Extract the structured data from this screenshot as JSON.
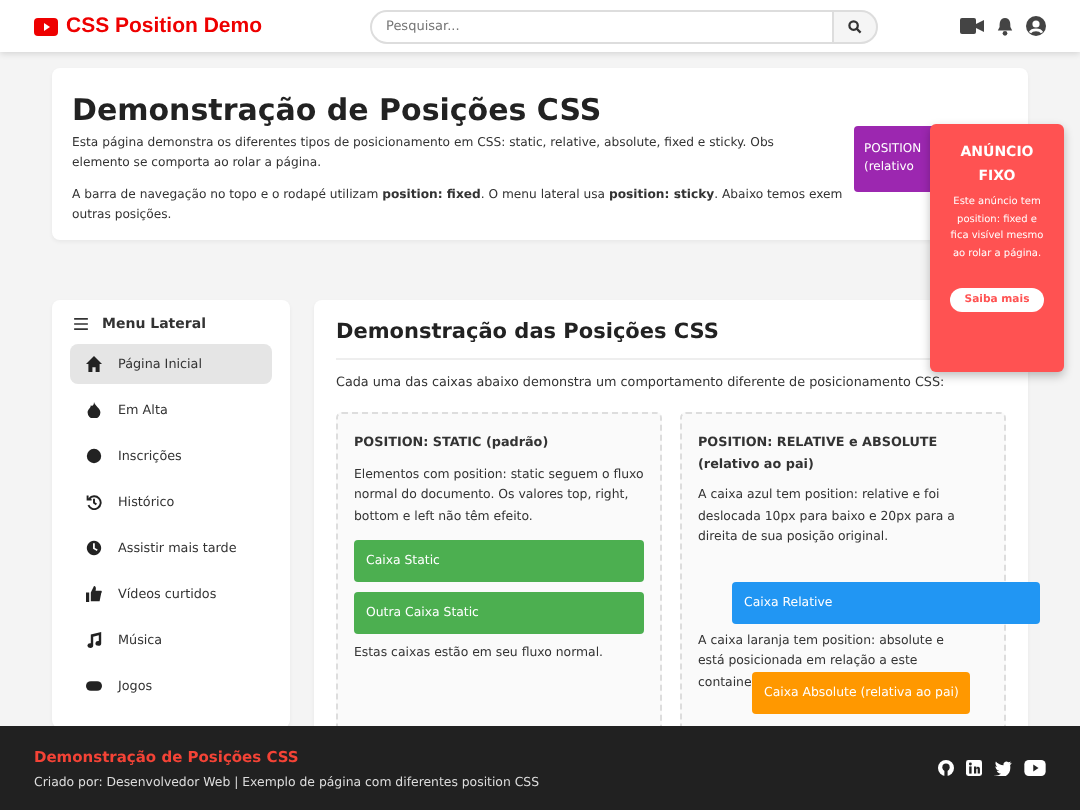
{
  "header": {
    "logo": "CSS Position Demo",
    "search": {
      "placeholder": "Pesquisar..."
    }
  },
  "intro": {
    "title": "Demonstração de Posições CSS",
    "paragraphs": [
      [
        "Esta página demonstra os diferentes tipos de posicionamento em CSS: static, relative, absolute, fixed e sticky. Obs",
        "elemento se comporta ao rolar a página."
      ],
      [
        "A barra de navegação no topo e o rodapé utilizam **position: fixed**. O menu lateral usa **position: sticky**. Abaixo temos exem",
        "outras posições."
      ]
    ],
    "overlay_lines": [
      "POSITION",
      "(relativo"
    ]
  },
  "sidebar": {
    "title": "Menu Lateral",
    "items": [
      {
        "label": "Página Inicial",
        "selected": true
      },
      {
        "label": "Em Alta",
        "selected": false
      },
      {
        "label": "Inscrições",
        "selected": false
      },
      {
        "label": "Histórico",
        "selected": false
      },
      {
        "label": "Assistir mais tarde",
        "selected": false
      },
      {
        "label": "Vídeos curtidos",
        "selected": false
      },
      {
        "label": "Música",
        "selected": false
      },
      {
        "label": "Jogos",
        "selected": false
      }
    ]
  },
  "demo": {
    "title": "Demonstração das Posições CSS",
    "description": "Cada uma das caixas abaixo demonstra um comportamento diferente de posicionamento CSS:",
    "static": {
      "title": "POSITION: STATIC (padrão)",
      "text": "Elementos com position: static seguem o fluxo normal do documento. Os valores top, right, bottom e left não têm efeito.",
      "boxes": [
        "Caixa Static",
        "Outra Caixa Static"
      ],
      "note": "Estas caixas estão em seu fluxo normal."
    },
    "relative": {
      "title": "POSITION: RELATIVE e ABSOLUTE (relativo ao pai)",
      "text": "A caixa azul tem position: relative e foi deslocada 10px para baixo e 20px para a direita de sua posição original.",
      "relative_box": "Caixa Relative",
      "note_lines": [
        "A caixa laranja tem position: absolute e",
        "está posicionada em relação a este",
        "containe"
      ],
      "absolute_box": "Caixa Absolute (relativa ao pai)"
    }
  },
  "ad": {
    "title": "ANÚNCIO FIXO",
    "text": "Este anúncio tem position: fixed e fica visível mesmo ao rolar a página.",
    "button": "Saiba mais"
  },
  "footer": {
    "title": "Demonstração de Posições CSS",
    "credit": "Criado por: Desenvolvedor Web | Exemplo de página com diferentes position CSS"
  }
}
